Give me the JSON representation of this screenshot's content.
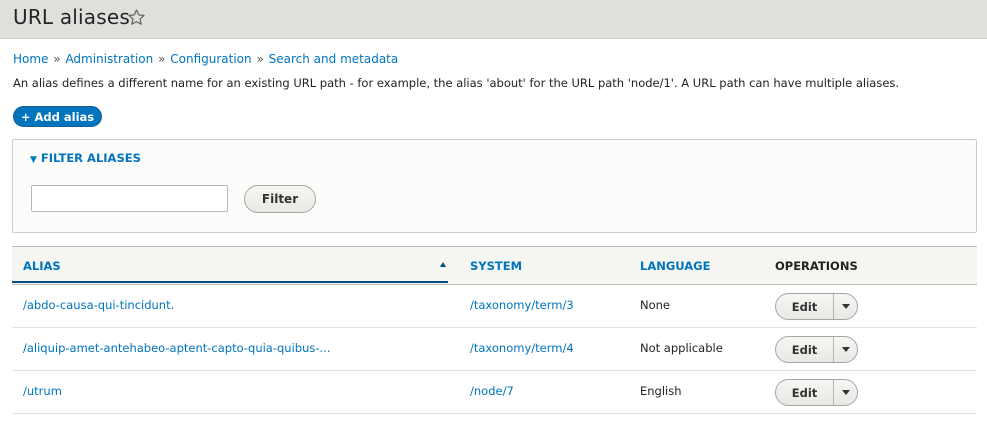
{
  "page": {
    "title": "URL aliases"
  },
  "breadcrumb": [
    "Home",
    "Administration",
    "Configuration",
    "Search and metadata"
  ],
  "description": "An alias defines a different name for an existing URL path - for example, the alias 'about' for the URL path 'node/1'. A URL path can have multiple aliases.",
  "actions": {
    "add_alias": "+ Add alias"
  },
  "filter": {
    "legend": "FILTER ALIASES",
    "input_value": "",
    "button": "Filter"
  },
  "table": {
    "headers": {
      "alias": "ALIAS",
      "system": "SYSTEM",
      "language": "LANGUAGE",
      "operations": "OPERATIONS"
    },
    "rows": [
      {
        "alias": "/abdo-causa-qui-tincidunt.",
        "system": "/taxonomy/term/3",
        "language": "None",
        "op": "Edit"
      },
      {
        "alias": "/aliquip-amet-antehabeo-aptent-capto-quia-quibus-...",
        "system": "/taxonomy/term/4",
        "language": "Not applicable",
        "op": "Edit"
      },
      {
        "alias": "/utrum",
        "system": "/node/7",
        "language": "English",
        "op": "Edit"
      }
    ]
  },
  "colors": {
    "link": "#0074bd",
    "header_bg": "#e1dfd9",
    "primary_button": "#0074bd"
  }
}
